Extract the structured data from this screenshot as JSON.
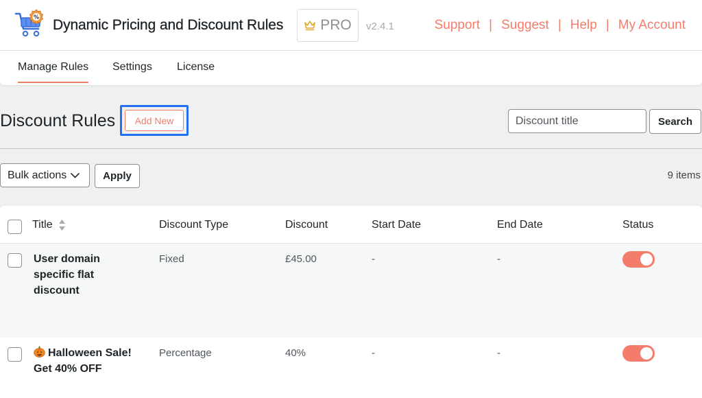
{
  "header": {
    "app_title": "Dynamic Pricing and Discount Rules",
    "badge_label": "PRO",
    "version": "v2.4.1",
    "links": [
      {
        "label": "Support"
      },
      {
        "label": "Suggest"
      },
      {
        "label": "Help"
      },
      {
        "label": "My Account"
      }
    ],
    "separator": "|"
  },
  "tabs": [
    {
      "label": "Manage Rules",
      "active": true
    },
    {
      "label": "Settings",
      "active": false
    },
    {
      "label": "License",
      "active": false
    }
  ],
  "page": {
    "heading": "Discount Rules",
    "add_new_label": "Add New",
    "search_placeholder": "Discount title",
    "search_button": "Search",
    "bulk_actions_label": "Bulk actions",
    "apply_label": "Apply",
    "items_count": "9 items"
  },
  "table": {
    "columns": [
      "Title",
      "Discount Type",
      "Discount",
      "Start Date",
      "End Date",
      "Status"
    ],
    "rows": [
      {
        "title_lines": [
          "User domain",
          "specific flat",
          "discount"
        ],
        "discount_type": "Fixed",
        "discount": "£45.00",
        "start_date": "-",
        "end_date": "-",
        "status": "on"
      },
      {
        "title_lines": [
          "Halloween Sale!",
          "Get 40% OFF"
        ],
        "discount_type": "Percentage",
        "discount": "40%",
        "start_date": "-",
        "end_date": "-",
        "status": "on",
        "icon": "pumpkin-icon"
      }
    ]
  },
  "colors": {
    "accent": "#f47c6b",
    "focus_outline": "#2271f1",
    "background": "#f0f0f1"
  }
}
